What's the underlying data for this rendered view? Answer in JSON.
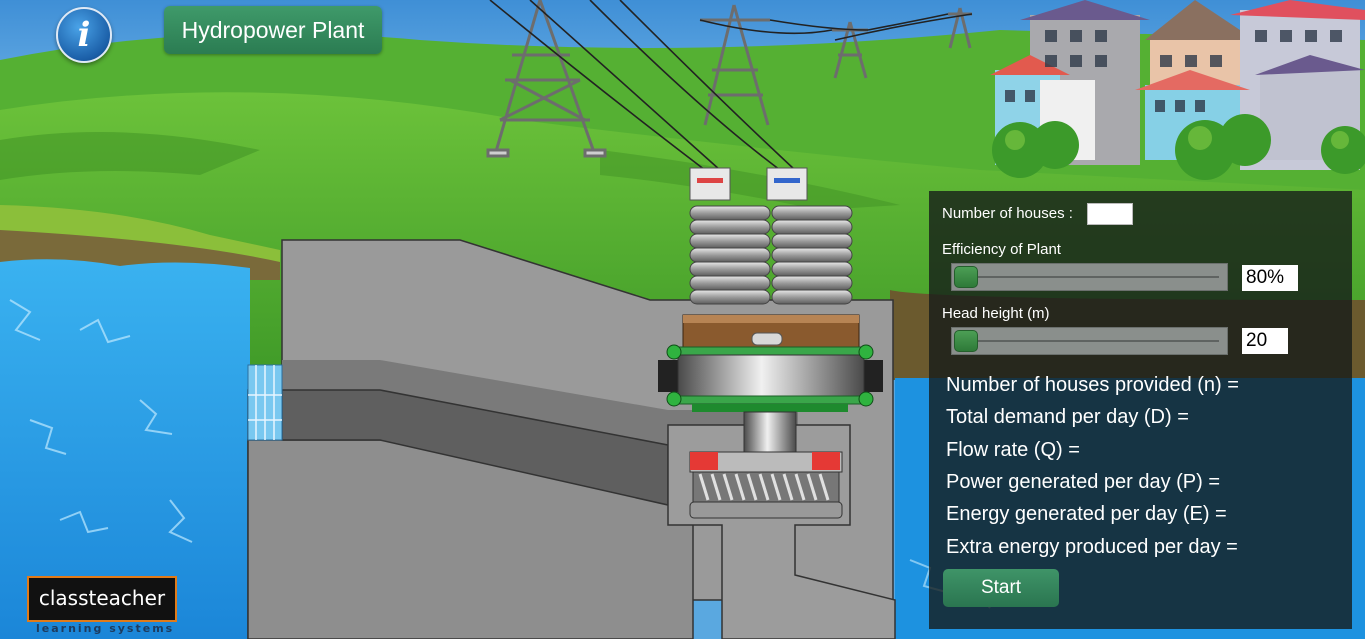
{
  "header": {
    "info_icon": "info-icon",
    "title": "Hydropower Plant"
  },
  "controls": {
    "houses_label": "Number of houses :",
    "houses_value": "",
    "efficiency_label": "Efficiency of Plant",
    "efficiency_value": "80%",
    "efficiency_fraction": 0.0,
    "head_label": "Head height (m)",
    "head_value": "20",
    "head_fraction": 0.0
  },
  "results": [
    "Number of houses provided (n) =",
    "Total demand per day (D) =",
    "Flow rate (Q) =",
    "Power generated per day (P) =",
    "Energy generated per day (E) =",
    "Extra energy produced per day ="
  ],
  "start_label": "Start",
  "logo": {
    "name": "classteacher",
    "tagline": "learning systems"
  },
  "colors": {
    "accent_green": "#2e7d52",
    "panel_bg": "#141a18",
    "sky": "#5aa8e0",
    "grass": "#4caf2f",
    "water": "#2aa3e8"
  }
}
